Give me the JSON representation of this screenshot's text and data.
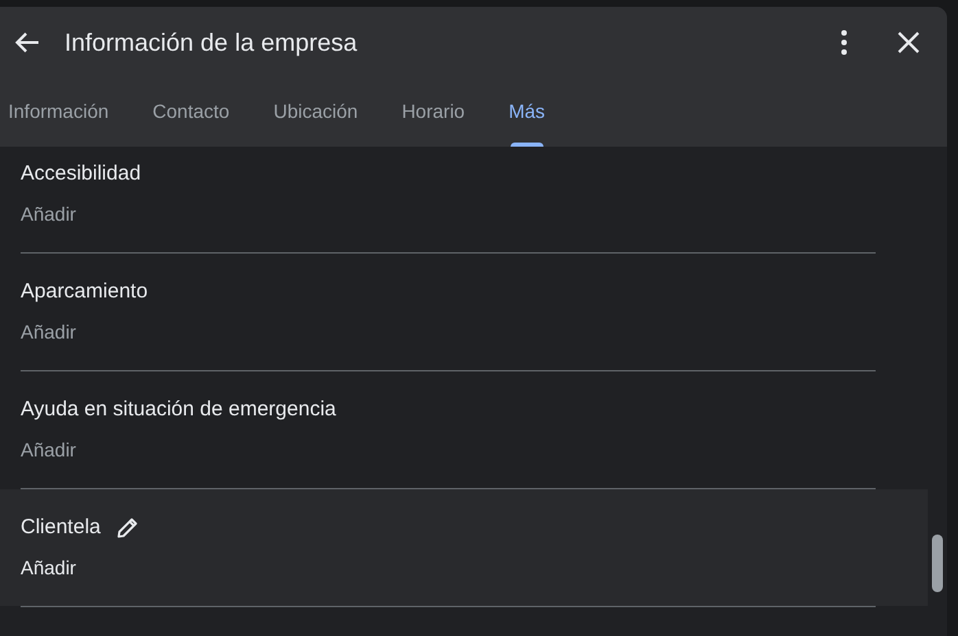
{
  "window": {
    "title": "Información de la empresa"
  },
  "tabs": [
    {
      "label": "Información",
      "selected": false
    },
    {
      "label": "Contacto",
      "selected": false
    },
    {
      "label": "Ubicación",
      "selected": false
    },
    {
      "label": "Horario",
      "selected": false
    },
    {
      "label": "Más",
      "selected": true
    }
  ],
  "attributes": [
    {
      "title": "Accesibilidad",
      "action": "Añadir",
      "highlighted": false
    },
    {
      "title": "Aparcamiento",
      "action": "Añadir",
      "highlighted": false
    },
    {
      "title": "Ayuda en situación de emergencia",
      "action": "Añadir",
      "highlighted": false
    },
    {
      "title": "Clientela",
      "action": "Añadir",
      "highlighted": true
    }
  ]
}
